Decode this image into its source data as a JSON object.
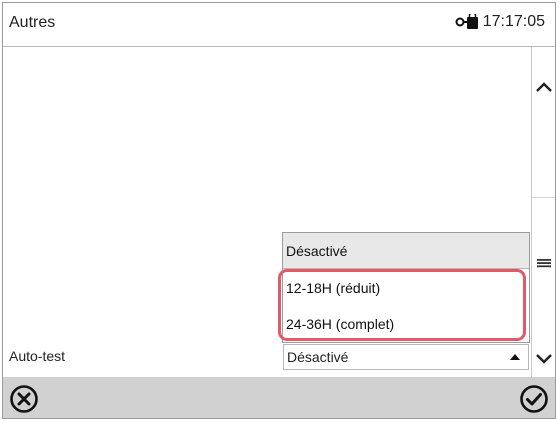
{
  "header": {
    "title": "Autres",
    "time": "17:17:05",
    "status_icon": "lock-key-icon"
  },
  "form": {
    "field_label": "Auto-test",
    "selected_value": "Désactivé"
  },
  "dropdown": {
    "options": [
      {
        "label": "Désactivé"
      },
      {
        "label": "12-18H (réduit)"
      },
      {
        "label": "24-36H (complet)"
      }
    ]
  },
  "icons": {
    "scroll_up": "chevron-up-icon",
    "scroll_thumb": "menu-lines-icon",
    "scroll_down": "chevron-down-icon",
    "cancel": "circle-x-icon",
    "confirm": "circle-check-icon"
  },
  "colors": {
    "highlight": "#e25a68",
    "footer": "#d1d1d1",
    "selected_option": "#e8e8e8"
  }
}
